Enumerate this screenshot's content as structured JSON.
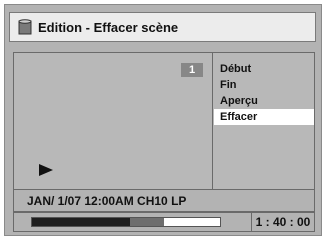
{
  "title": {
    "text": "Edition - Effacer scène",
    "icon": "disc-icon"
  },
  "preview": {
    "scene_number": "1",
    "playback_icon": "play-icon"
  },
  "menu": {
    "items": [
      {
        "label": "Début"
      },
      {
        "label": "Fin"
      },
      {
        "label": "Aperçu"
      },
      {
        "label": "Effacer"
      }
    ],
    "selected_index": 3
  },
  "status": {
    "info": "JAN/ 1/07 12:00AM CH10   LP"
  },
  "playback": {
    "progress_played_fraction": 0.52,
    "progress_buffered_fraction": 0.7,
    "time": "1 : 40 : 00"
  },
  "colors": {
    "background": "#b3b3b3",
    "title_bar": "#ececec",
    "selected_item": "#ffffff",
    "badge": "#878787",
    "progress_dark": "#1e1e1e",
    "progress_mid": "#6e6e6e"
  }
}
